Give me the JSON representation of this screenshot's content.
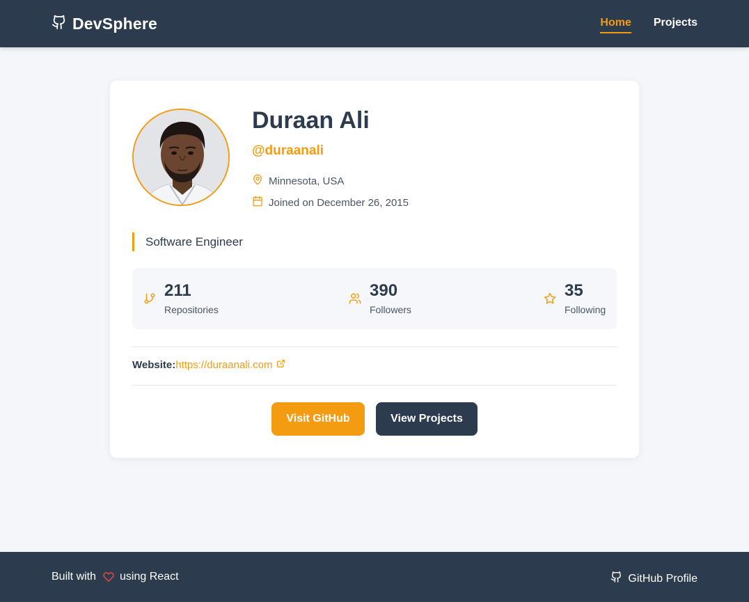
{
  "header": {
    "brand": "DevSphere",
    "nav": [
      {
        "label": "Home",
        "active": true
      },
      {
        "label": "Projects",
        "active": false
      }
    ]
  },
  "profile": {
    "name": "Duraan Ali",
    "username": "@duraanali",
    "location": "Minnesota, USA",
    "joined": "Joined on December 26, 2015",
    "bio": "Software Engineer",
    "stats": {
      "repositories": {
        "value": "211",
        "label": "Repositories"
      },
      "followers": {
        "value": "390",
        "label": "Followers"
      },
      "following": {
        "value": "35",
        "label": "Following"
      }
    },
    "website": {
      "label": "Website:",
      "url": "https://duraanali.com"
    },
    "buttons": {
      "github": "Visit GitHub",
      "projects": "View Projects"
    }
  },
  "footer": {
    "built_prefix": "Built with",
    "built_suffix": "using React",
    "github_profile": "GitHub Profile"
  },
  "colors": {
    "accent": "#f39c12",
    "dark": "#2d3b4e",
    "heart": "#e74c3c"
  },
  "icons": [
    "github-icon",
    "location-pin-icon",
    "calendar-icon",
    "git-branch-icon",
    "users-icon",
    "star-icon",
    "external-link-icon",
    "heart-icon"
  ]
}
